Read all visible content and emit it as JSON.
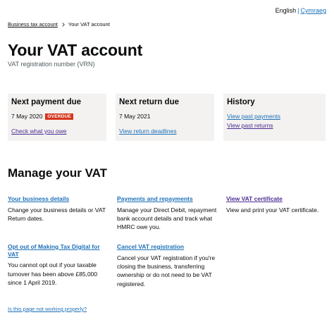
{
  "language": {
    "english": "English",
    "separator": "|",
    "welsh": "Cymraeg"
  },
  "breadcrumb": {
    "parent": "Business tax account",
    "current": "Your VAT account"
  },
  "page": {
    "title": "Your VAT account",
    "subtitle": "VAT registration number (VRN)"
  },
  "cards": {
    "payment": {
      "heading": "Next payment due",
      "date": "7 May 2020",
      "badge": "OVERDUE",
      "link": "Check what you owe"
    },
    "returns": {
      "heading": "Next return due",
      "date": "7 May 2021",
      "link": "View return deadlines"
    },
    "history": {
      "heading": "History",
      "link1": "View past payments",
      "link2": "View past returns"
    }
  },
  "manage": {
    "heading": "Manage your VAT",
    "tiles": [
      {
        "title": "Your business details",
        "desc": "Change your business details or VAT Return dates."
      },
      {
        "title": "Payments and repayments",
        "desc": "Manage your Direct Debit, repayment bank account details and track what HMRC owe you."
      },
      {
        "title": "View VAT certificate",
        "desc": "View and print your VAT certificate."
      },
      {
        "title": "Opt out of Making Tax Digital for VAT",
        "desc": "You cannot opt out if your taxable turnover has been above £85,000 since 1 April 2019."
      },
      {
        "title": "Cancel VAT registration",
        "desc": "Cancel your VAT registration if you're closing the business, transferring ownership or do not need to be VAT registered."
      }
    ]
  },
  "footer": {
    "broken_link": "Is this page not working properly?"
  },
  "colors": {
    "link": "#1d70b8",
    "visited": "#4c2c92",
    "overdue": "#d4351c",
    "panel": "#f3f2f1",
    "text": "#0b0c0c"
  }
}
